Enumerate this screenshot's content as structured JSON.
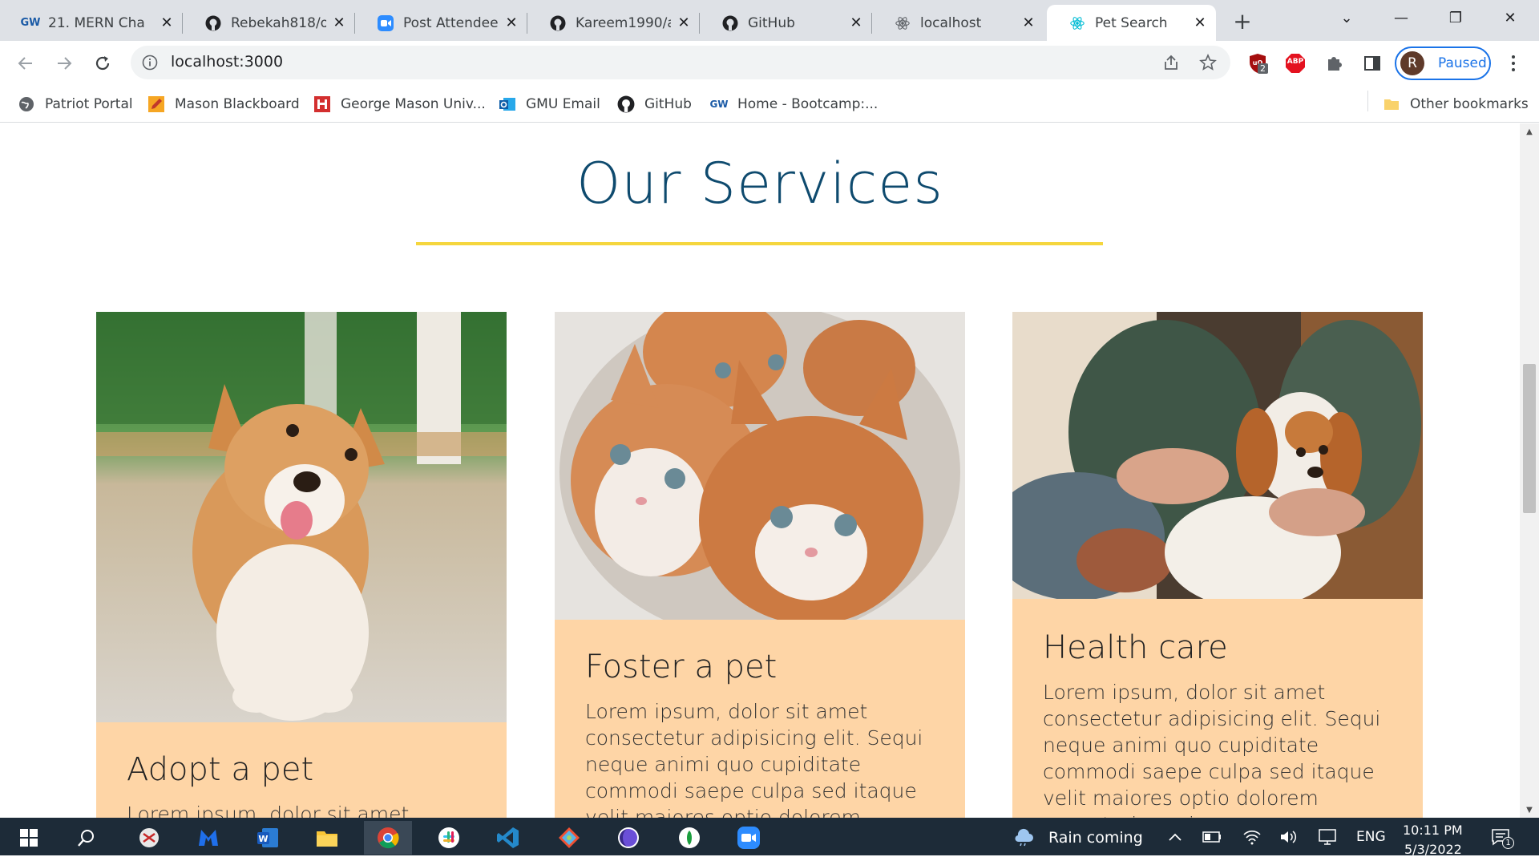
{
  "browser": {
    "tabs": [
      {
        "title": "21. MERN Cha",
        "favicon": "gw-icon",
        "active": false
      },
      {
        "title": "Rebekah818/o",
        "favicon": "github-icon",
        "active": false
      },
      {
        "title": "Post Attendee",
        "favicon": "zoom-icon",
        "active": false
      },
      {
        "title": "Kareem1990/a",
        "favicon": "github-icon",
        "active": false
      },
      {
        "title": "GitHub",
        "favicon": "github-icon",
        "active": false
      },
      {
        "title": "localhost",
        "favicon": "react-icon",
        "active": false
      },
      {
        "title": "Pet Search",
        "favicon": "react-icon",
        "active": true
      }
    ],
    "address": "localhost:3000",
    "profile": {
      "initial": "R",
      "status": "Paused"
    },
    "extensions": {
      "ublock_badge": "2",
      "abp_label": "ABP"
    },
    "bookmarks": [
      {
        "label": "Patriot Portal",
        "icon": "globe-icon"
      },
      {
        "label": "Mason Blackboard",
        "icon": "pencil-icon"
      },
      {
        "label": "George Mason Univ...",
        "icon": "gmu-icon"
      },
      {
        "label": "GMU Email",
        "icon": "outlook-icon"
      },
      {
        "label": "GitHub",
        "icon": "github-icon"
      },
      {
        "label": "Home - Bootcamp:...",
        "icon": "gw-icon"
      }
    ],
    "other_bookmarks": "Other bookmarks"
  },
  "page": {
    "section_title": "Our Services",
    "accent_color": "#f5d63d",
    "title_color": "#0e4a6e",
    "card_color": "#fed5a6",
    "cards": [
      {
        "title": "Adopt a pet",
        "text": "Lorem ipsum, dolor sit amet",
        "image": "corgi puppy"
      },
      {
        "title": "Foster a pet",
        "text": "Lorem ipsum, dolor sit amet consectetur adipisicing elit. Sequi neque animi quo cupiditate commodi saepe culpa sed itaque velit maiores optio dolorem excepturi aperiam",
        "image": "orange kittens"
      },
      {
        "title": "Health care",
        "text": "Lorem ipsum, dolor sit amet consectetur adipisicing elit. Sequi neque animi quo cupiditate commodi saepe culpa sed itaque velit maiores optio dolorem excepturi aperiam",
        "image": "puppy on lap"
      }
    ]
  },
  "taskbar": {
    "weather": "Rain coming",
    "language": "ENG",
    "time": "10:11 PM",
    "date": "5/3/2022",
    "notification_count": "1"
  }
}
